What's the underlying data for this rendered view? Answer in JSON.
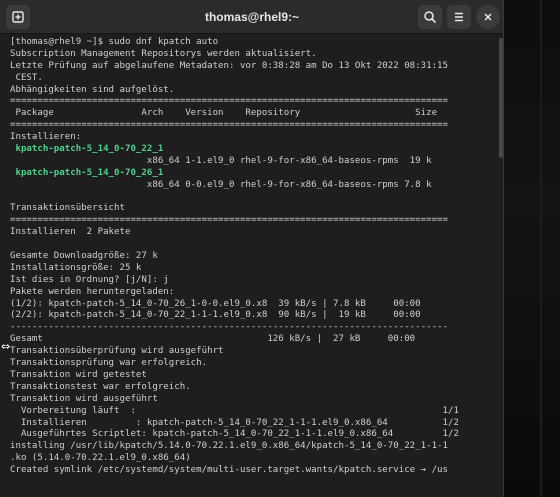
{
  "window": {
    "title": "thomas@rhel9:~",
    "icons": {
      "new_tab": "new-tab-icon",
      "search": "search-icon",
      "menu": "hamburger-menu-icon",
      "close": "close-icon"
    }
  },
  "terminal": {
    "lines": [
      {
        "text": "[thomas@rhel9 ~]$ sudo dnf kpatch auto"
      },
      {
        "text": "Subscription Management Repositorys werden aktualisiert."
      },
      {
        "text": "Letzte Prüfung auf abgelaufene Metadaten: vor 0:38:28 am Do 13 Okt 2022 08:31:15"
      },
      {
        "text": " CEST."
      },
      {
        "text": "Abhängigkeiten sind aufgelöst."
      },
      {
        "text": "================================================================================"
      },
      {
        "text": " Package                Arch    Version    Repository                     Size"
      },
      {
        "text": "================================================================================"
      },
      {
        "text": "Installieren:"
      },
      {
        "text": " kpatch-patch-5_14_0-70_22_1",
        "class": "pkg"
      },
      {
        "text": "                         x86_64 1-1.el9_0 rhel-9-for-x86_64-baseos-rpms  19 k"
      },
      {
        "text": " kpatch-patch-5_14_0-70_26_1",
        "class": "pkg"
      },
      {
        "text": "                         x86_64 0-0.el9_0 rhel-9-for-x86_64-baseos-rpms 7.8 k"
      },
      {
        "text": ""
      },
      {
        "text": "Transaktionsübersicht"
      },
      {
        "text": "================================================================================"
      },
      {
        "text": "Installieren  2 Pakete"
      },
      {
        "text": ""
      },
      {
        "text": "Gesamte Downloadgröße: 27 k"
      },
      {
        "text": "Installationsgröße: 25 k"
      },
      {
        "text": "Ist dies in Ordnung? [j/N]: j"
      },
      {
        "text": "Pakete werden heruntergeladen:"
      },
      {
        "text": "(1/2): kpatch-patch-5_14_0-70_26_1-0-0.el9_0.x8  39 kB/s | 7.8 kB     00:00"
      },
      {
        "text": "(2/2): kpatch-patch-5_14_0-70_22_1-1-1.el9_0.x8  90 kB/s |  19 kB     00:00"
      },
      {
        "text": "--------------------------------------------------------------------------------"
      },
      {
        "text": "Gesamt                                         126 kB/s |  27 kB     00:00"
      },
      {
        "text": "Transaktionsüberprüfung wird ausgeführt"
      },
      {
        "text": "Transaktionsprüfung war erfolgreich."
      },
      {
        "text": "Transaktion wird getestet"
      },
      {
        "text": "Transaktionstest war erfolgreich."
      },
      {
        "text": "Transaktion wird ausgeführt"
      },
      {
        "text": "  Vorbereitung läuft  :                                                        1/1"
      },
      {
        "text": "  Installieren         : kpatch-patch-5_14_0-70_22_1-1-1.el9_0.x86_64          1/2"
      },
      {
        "text": "  Ausgeführtes Scriptlet: kpatch-patch-5_14_0-70_22_1-1-1.el9_0.x86_64         1/2"
      },
      {
        "text": "installing /usr/lib/kpatch/5.14.0-70.22.1.el9_0.x86_64/kpatch-5_14_0-70_22_1-1-1"
      },
      {
        "text": ".ko (5.14.0-70.22.1.el9_0.x86_64)"
      },
      {
        "text": "Created symlink /etc/systemd/system/multi-user.target.wants/kpatch.service → /us"
      }
    ]
  }
}
